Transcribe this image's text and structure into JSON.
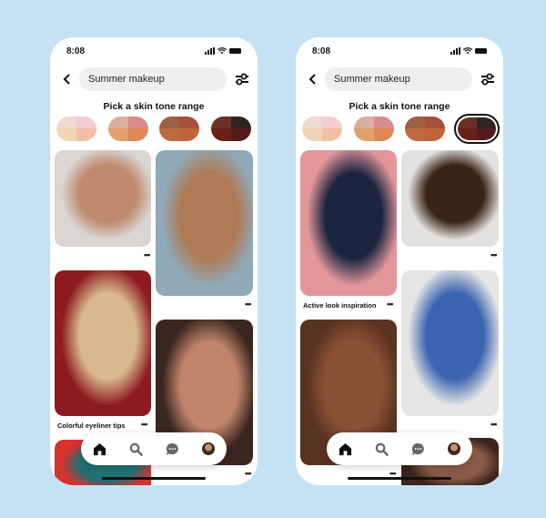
{
  "screens": [
    {
      "status": {
        "time": "8:08"
      },
      "search": {
        "value": "Summer makeup"
      },
      "pick_title": "Pick a skin tone range",
      "selected_swatch": -1,
      "pins": [
        {
          "caption": "",
          "photo": "bald smiling woman, light background",
          "colors": [
            "#d9d6d3",
            "#c08a6e"
          ]
        },
        {
          "caption": "",
          "photo": "woman face close-up, blue brick wall",
          "colors": [
            "#8fa9b8",
            "#b07a55"
          ]
        },
        {
          "caption": "Colorful eyeliner tips",
          "photo": "blonde woman, red background",
          "colors": [
            "#8c1a1e",
            "#d8b88c"
          ]
        },
        {
          "caption": "",
          "photo": "eye close-up with white eyeshadow",
          "colors": [
            "#3a2520",
            "#c0846a"
          ]
        },
        {
          "caption": "",
          "photo": "woman with teal hair, red background",
          "colors": [
            "#d6322e",
            "#1f6f73"
          ]
        }
      ]
    },
    {
      "status": {
        "time": "8:08"
      },
      "search": {
        "value": "Summer makeup"
      },
      "pick_title": "Pick a skin tone range",
      "selected_swatch": 3,
      "pins": [
        {
          "caption": "Active look inspiration",
          "photo": "woman in navy top, pink background",
          "colors": [
            "#e3969a",
            "#1c2540"
          ]
        },
        {
          "caption": "",
          "photo": "man with locs, profile",
          "colors": [
            "#e4e2e0",
            "#3a2418"
          ]
        },
        {
          "caption": "",
          "photo": "eye close-up with white eyeliner",
          "colors": [
            "#5a3222",
            "#8a5235"
          ]
        },
        {
          "caption": "",
          "photo": "woman with colorful eyeliner, blue blazer",
          "colors": [
            "#e6e6e6",
            "#3a64b0"
          ]
        },
        {
          "caption": "",
          "photo": "eye close-up, dark skin",
          "colors": [
            "#3a241c",
            "#8a5a48"
          ]
        }
      ]
    }
  ],
  "swatches": [
    [
      "#efd9cf",
      "#f5cdd0",
      "#f2d5b4",
      "#f3bea4"
    ],
    [
      "#dcaea0",
      "#d98c8a",
      "#e2a06c",
      "#df8758"
    ],
    [
      "#9c6044",
      "#a4503c",
      "#bd6c40",
      "#c0643c"
    ],
    [
      "#6a3224",
      "#302420",
      "#6a2018",
      "#541a1c"
    ]
  ],
  "nav": [
    "home-icon",
    "search-icon",
    "messages-icon",
    "profile-avatar"
  ],
  "more_label": "•••"
}
